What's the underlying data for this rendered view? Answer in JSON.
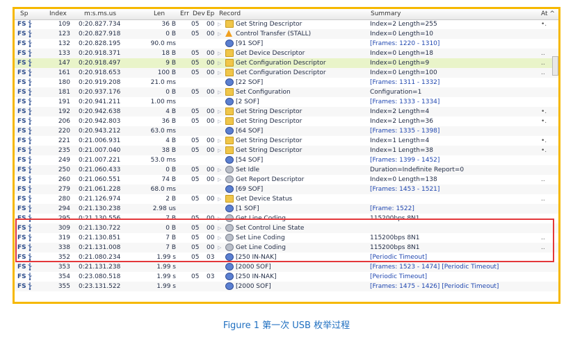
{
  "columns": {
    "sp": "Sp",
    "index": "Index",
    "time": "m:s.ms.us",
    "len": "Len",
    "err": "Err",
    "dev": "Dev",
    "ep": "Ep",
    "record": "Record",
    "summary": "Summary",
    "extra": "At ^"
  },
  "rows": [
    {
      "sp": "FS",
      "index": "109",
      "time": "0:20.827.734",
      "len": "36 B",
      "dev": "05",
      "ep": "00",
      "expand": "▷",
      "icon": "descriptor-icon",
      "record": "Get String Descriptor",
      "summary": "Index=2 Length=255",
      "extra": "•.",
      "selected": false
    },
    {
      "sp": "FS",
      "index": "123",
      "time": "0:20.827.918",
      "len": "0 B",
      "dev": "05",
      "ep": "00",
      "expand": "▷",
      "icon": "warning-icon",
      "record": "Control Transfer (STALL)",
      "summary": "Index=0 Length=10",
      "extra": "",
      "selected": false
    },
    {
      "sp": "FS",
      "index": "132",
      "time": "0:20.828.195",
      "len": "90.0 ms",
      "dev": "",
      "ep": "",
      "expand": "",
      "icon": "sof-icon",
      "record": "[91 SOF]",
      "summary": "[Frames: 1220 - 1310]",
      "extra": "",
      "selected": false
    },
    {
      "sp": "FS",
      "index": "133",
      "time": "0:20.918.371",
      "len": "18 B",
      "dev": "05",
      "ep": "00",
      "expand": "▷",
      "icon": "descriptor-icon",
      "record": "Get Device Descriptor",
      "summary": "Index=0 Length=18",
      "extra": "..",
      "selected": false
    },
    {
      "sp": "FS",
      "index": "147",
      "time": "0:20.918.497",
      "len": "9 B",
      "dev": "05",
      "ep": "00",
      "expand": "▷",
      "icon": "descriptor-icon",
      "record": "Get Configuration Descriptor",
      "summary": "Index=0 Length=9",
      "extra": "..",
      "selected": true
    },
    {
      "sp": "FS",
      "index": "161",
      "time": "0:20.918.653",
      "len": "100 B",
      "dev": "05",
      "ep": "00",
      "expand": "▷",
      "icon": "descriptor-icon",
      "record": "Get Configuration Descriptor",
      "summary": "Index=0 Length=100",
      "extra": "..",
      "selected": false
    },
    {
      "sp": "FS",
      "index": "180",
      "time": "0:20.919.208",
      "len": "21.0 ms",
      "dev": "",
      "ep": "",
      "expand": "",
      "icon": "sof-icon",
      "record": "[22 SOF]",
      "summary": "[Frames: 1311 - 1332]",
      "extra": "",
      "selected": false
    },
    {
      "sp": "FS",
      "index": "181",
      "time": "0:20.937.176",
      "len": "0 B",
      "dev": "05",
      "ep": "00",
      "expand": "▷",
      "icon": "descriptor-icon",
      "record": "Set Configuration",
      "summary": "Configuration=1",
      "extra": "",
      "selected": false
    },
    {
      "sp": "FS",
      "index": "191",
      "time": "0:20.941.211",
      "len": "1.00 ms",
      "dev": "",
      "ep": "",
      "expand": "",
      "icon": "sof-icon",
      "record": "[2 SOF]",
      "summary": "[Frames: 1333 - 1334]",
      "extra": "",
      "selected": false
    },
    {
      "sp": "FS",
      "index": "192",
      "time": "0:20.942.638",
      "len": "4 B",
      "dev": "05",
      "ep": "00",
      "expand": "▷",
      "icon": "descriptor-icon",
      "record": "Get String Descriptor",
      "summary": "Index=2 Length=4",
      "extra": "•.",
      "selected": false
    },
    {
      "sp": "FS",
      "index": "206",
      "time": "0:20.942.803",
      "len": "36 B",
      "dev": "05",
      "ep": "00",
      "expand": "▷",
      "icon": "descriptor-icon",
      "record": "Get String Descriptor",
      "summary": "Index=2 Length=36",
      "extra": "•.",
      "selected": false
    },
    {
      "sp": "FS",
      "index": "220",
      "time": "0:20.943.212",
      "len": "63.0 ms",
      "dev": "",
      "ep": "",
      "expand": "",
      "icon": "sof-icon",
      "record": "[64 SOF]",
      "summary": "[Frames: 1335 - 1398]",
      "extra": "",
      "selected": false
    },
    {
      "sp": "FS",
      "index": "221",
      "time": "0:21.006.931",
      "len": "4 B",
      "dev": "05",
      "ep": "00",
      "expand": "▷",
      "icon": "descriptor-icon",
      "record": "Get String Descriptor",
      "summary": "Index=1 Length=4",
      "extra": "•.",
      "selected": false
    },
    {
      "sp": "FS",
      "index": "235",
      "time": "0:21.007.040",
      "len": "38 B",
      "dev": "05",
      "ep": "00",
      "expand": "▷",
      "icon": "descriptor-icon",
      "record": "Get String Descriptor",
      "summary": "Index=1 Length=38",
      "extra": "•.",
      "selected": false
    },
    {
      "sp": "FS",
      "index": "249",
      "time": "0:21.007.221",
      "len": "53.0 ms",
      "dev": "",
      "ep": "",
      "expand": "",
      "icon": "sof-icon",
      "record": "[54 SOF]",
      "summary": "[Frames: 1399 - 1452]",
      "extra": "",
      "selected": false
    },
    {
      "sp": "FS",
      "index": "250",
      "time": "0:21.060.433",
      "len": "0 B",
      "dev": "05",
      "ep": "00",
      "expand": "▷",
      "icon": "class-icon",
      "record": "Set Idle",
      "summary": "Duration=Indefinite Report=0",
      "extra": "",
      "selected": false
    },
    {
      "sp": "FS",
      "index": "260",
      "time": "0:21.060.551",
      "len": "74 B",
      "dev": "05",
      "ep": "00",
      "expand": "▷",
      "icon": "class-icon",
      "record": "Get Report Descriptor",
      "summary": "Index=0 Length=138",
      "extra": "..",
      "selected": false
    },
    {
      "sp": "FS",
      "index": "279",
      "time": "0:21.061.228",
      "len": "68.0 ms",
      "dev": "",
      "ep": "",
      "expand": "",
      "icon": "sof-icon",
      "record": "[69 SOF]",
      "summary": "[Frames: 1453 - 1521]",
      "extra": "",
      "selected": false
    },
    {
      "sp": "FS",
      "index": "280",
      "time": "0:21.126.974",
      "len": "2 B",
      "dev": "05",
      "ep": "00",
      "expand": "▷",
      "icon": "descriptor-icon",
      "record": "Get Device Status",
      "summary": "",
      "extra": "..",
      "selected": false
    },
    {
      "sp": "FS",
      "index": "294",
      "time": "0:21.130.238",
      "len": "2.98 us",
      "dev": "",
      "ep": "",
      "expand": "",
      "icon": "sof-icon",
      "record": "[1 SOF]",
      "summary": "[Frame: 1522]",
      "extra": "",
      "selected": false
    },
    {
      "sp": "FS",
      "index": "295",
      "time": "0:21.130.556",
      "len": "7 B",
      "dev": "05",
      "ep": "00",
      "expand": "▷",
      "icon": "class-icon",
      "record": "Get Line Coding",
      "summary": "115200bps 8N1",
      "extra": "..",
      "selected": false
    },
    {
      "sp": "FS",
      "index": "309",
      "time": "0:21.130.722",
      "len": "0 B",
      "dev": "05",
      "ep": "00",
      "expand": "▷",
      "icon": "class-icon",
      "record": "Set Control Line State",
      "summary": "",
      "extra": "",
      "selected": false
    },
    {
      "sp": "FS",
      "index": "319",
      "time": "0:21.130.851",
      "len": "7 B",
      "dev": "05",
      "ep": "00",
      "expand": "▷",
      "icon": "class-icon",
      "record": "Set Line Coding",
      "summary": "115200bps 8N1",
      "extra": "..",
      "selected": false
    },
    {
      "sp": "FS",
      "index": "338",
      "time": "0:21.131.008",
      "len": "7 B",
      "dev": "05",
      "ep": "00",
      "expand": "▷",
      "icon": "class-icon",
      "record": "Get Line Coding",
      "summary": "115200bps 8N1",
      "extra": "..",
      "selected": false
    },
    {
      "sp": "FS",
      "index": "352",
      "time": "0:21.080.234",
      "len": "1.99 s",
      "dev": "05",
      "ep": "03",
      "expand": "",
      "icon": "sof-icon",
      "record": "[250 IN-NAK]",
      "summary": "[Periodic Timeout]",
      "extra": "",
      "selected": false
    },
    {
      "sp": "FS",
      "index": "353",
      "time": "0:21.131.238",
      "len": "1.99 s",
      "dev": "",
      "ep": "",
      "expand": "",
      "icon": "sof-icon",
      "record": "[2000 SOF]",
      "summary": "[Frames: 1523 - 1474] [Periodic Timeout]",
      "extra": "",
      "selected": false
    },
    {
      "sp": "FS",
      "index": "354",
      "time": "0:23.080.518",
      "len": "1.99 s",
      "dev": "05",
      "ep": "03",
      "expand": "",
      "icon": "sof-icon",
      "record": "[250 IN-NAK]",
      "summary": "[Periodic Timeout]",
      "extra": "",
      "selected": false
    },
    {
      "sp": "FS",
      "index": "355",
      "time": "0:23.131.522",
      "len": "1.99 s",
      "dev": "",
      "ep": "",
      "expand": "",
      "icon": "sof-icon",
      "record": "[2000 SOF]",
      "summary": "[Frames: 1475 - 1426] [Periodic Timeout]",
      "extra": "",
      "selected": false
    }
  ],
  "caption": "Figure 1 第一次 USB 枚举过程",
  "colors": {
    "frame_border": "#f6b800",
    "highlight_box": "#e3373a",
    "selected_row": "#e9f4c9",
    "link_text": "#2047b0",
    "caption_text": "#1f6fc0"
  }
}
